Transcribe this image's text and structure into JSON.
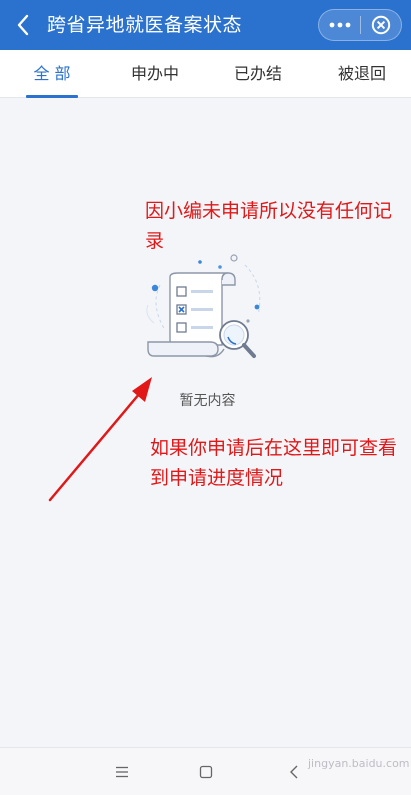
{
  "header": {
    "title": "跨省异地就医备案状态",
    "background": "#2a72ce",
    "back_icon": "chevron-left-icon",
    "more_icon": "more-dots-icon",
    "close_icon": "close-circle-icon"
  },
  "tabs": [
    {
      "label": "全 部",
      "active": true
    },
    {
      "label": "申办中",
      "active": false
    },
    {
      "label": "已办结",
      "active": false
    },
    {
      "label": "被退回",
      "active": false
    }
  ],
  "empty_state": {
    "text": "暂无内容",
    "illustration_icon": "empty-document-search-icon"
  },
  "annotations": {
    "top_note": "因小编未申请所以没有任何记录",
    "bottom_note": "如果你申请后在这里即可查看到申请进度情况",
    "color": "#e01818"
  },
  "system_nav": {
    "menu_icon": "menu-icon",
    "home_icon": "home-square-icon",
    "back_icon": "back-arrow-icon"
  },
  "watermark": {
    "text": "jingyan.baidu.com"
  }
}
